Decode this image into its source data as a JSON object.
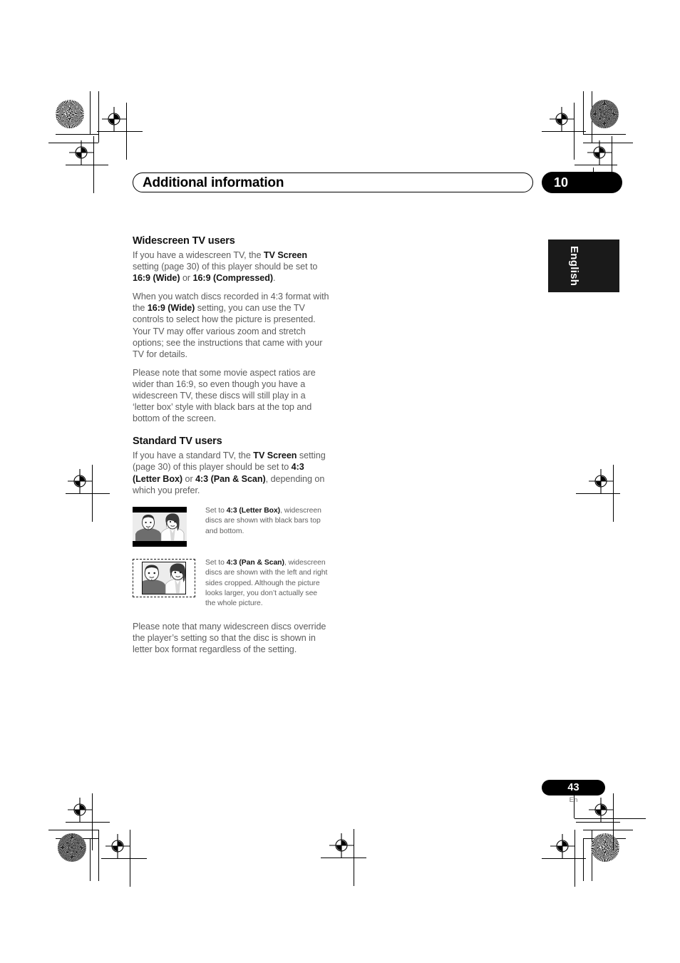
{
  "header": {
    "chapter_title": "Additional information",
    "chapter_number": "10"
  },
  "side_tab": {
    "language": "English"
  },
  "sections": [
    {
      "heading": "Widescreen TV users",
      "paragraphs": [
        [
          {
            "t": "If you have a widescreen TV, the ",
            "b": false
          },
          {
            "t": "TV Screen",
            "b": true
          },
          {
            "t": " setting (page 30) of this player should be set to ",
            "b": false
          },
          {
            "t": "16:9 (Wide)",
            "b": true
          },
          {
            "t": " or ",
            "b": false
          },
          {
            "t": "16:9 (Compressed)",
            "b": true
          },
          {
            "t": ".",
            "b": false
          }
        ],
        [
          {
            "t": "When you watch discs recorded in 4:3 format with the ",
            "b": false
          },
          {
            "t": "16:9 (Wide)",
            "b": true
          },
          {
            "t": " setting, you can use the TV controls to select how the picture is presented. Your TV may offer various zoom and stretch options; see the instructions that came with your TV for details.",
            "b": false
          }
        ],
        [
          {
            "t": "Please note that some movie aspect ratios are wider than 16:9, so even though you have a widescreen TV, these discs will still play in a ‘letter box’ style with black bars at the top and bottom of the screen.",
            "b": false
          }
        ]
      ]
    },
    {
      "heading": "Standard TV users",
      "paragraphs": [
        [
          {
            "t": "If you have a standard TV, the ",
            "b": false
          },
          {
            "t": "TV Screen",
            "b": true
          },
          {
            "t": " setting (page 30) of this player should be set to ",
            "b": false
          },
          {
            "t": "4:3 (Letter Box)",
            "b": true
          },
          {
            "t": " or ",
            "b": false
          },
          {
            "t": "4:3 (Pan & Scan)",
            "b": true
          },
          {
            "t": ", depending on which you prefer.",
            "b": false
          }
        ]
      ]
    }
  ],
  "figures": [
    {
      "thumb": "letterbox-tv-thumbnail",
      "caption": [
        {
          "t": "Set to ",
          "b": false
        },
        {
          "t": "4:3 (Letter Box)",
          "b": true
        },
        {
          "t": ", widescreen discs are shown with black bars top and bottom.",
          "b": false
        }
      ]
    },
    {
      "thumb": "panscan-tv-thumbnail",
      "caption": [
        {
          "t": "Set to ",
          "b": false
        },
        {
          "t": "4:3 (Pan & Scan)",
          "b": true
        },
        {
          "t": ", widescreen discs are shown with the left and right sides cropped. Although the picture looks larger, you don’t actually see the whole picture.",
          "b": false
        }
      ]
    }
  ],
  "closing_paragraphs": [
    [
      {
        "t": "Please note that many widescreen discs override the player’s setting so that the disc is shown in letter box format regardless of the setting.",
        "b": false
      }
    ]
  ],
  "footer": {
    "page_number": "43",
    "page_suffix": "En"
  },
  "colors": {
    "ink_black": "#000000",
    "body_gray": "#5c5c5c",
    "tab_black": "#1a1a1a",
    "paper": "#ffffff"
  }
}
